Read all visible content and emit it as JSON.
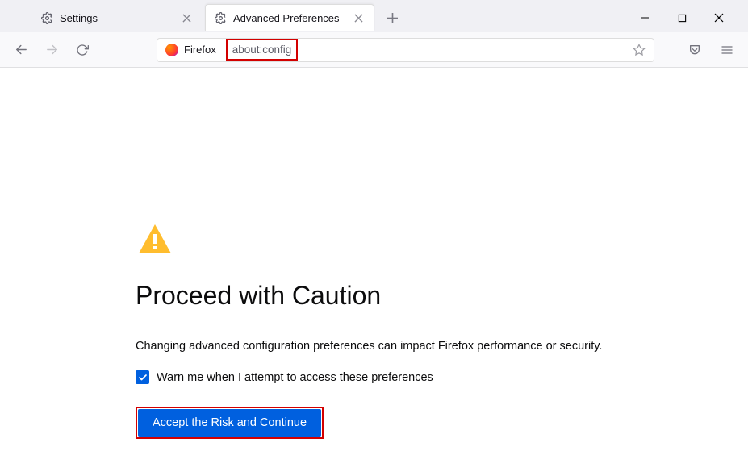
{
  "tabs": [
    {
      "label": "Settings"
    },
    {
      "label": "Advanced Preferences"
    }
  ],
  "toolbar": {
    "identity_label": "Firefox",
    "url": "about:config"
  },
  "page": {
    "heading": "Proceed with Caution",
    "description": "Changing advanced configuration preferences can impact Firefox performance or security.",
    "checkbox_label": "Warn me when I attempt to access these preferences",
    "accept_label": "Accept the Risk and Continue"
  }
}
